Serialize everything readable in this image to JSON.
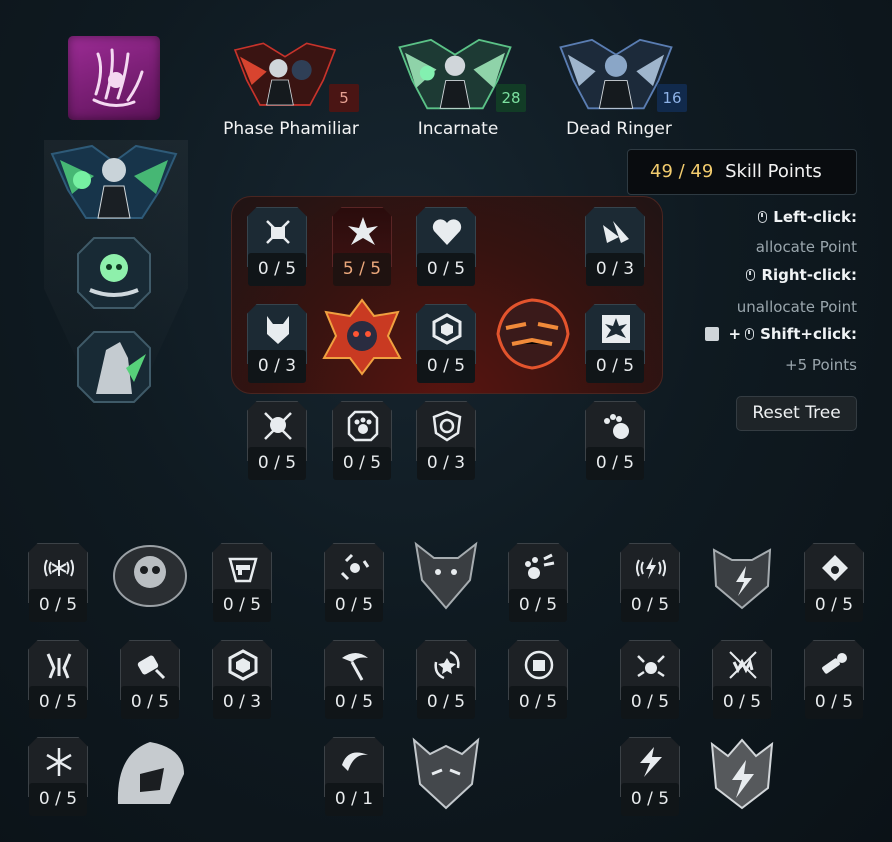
{
  "specs": [
    {
      "name": "Phase Phamiliar",
      "level": "5",
      "accent": "#c7332b",
      "level_bg": "#4a1514",
      "level_color": "#e7a193"
    },
    {
      "name": "Incarnate",
      "level": "28",
      "accent": "#5bc287",
      "level_bg": "#123c26",
      "level_color": "#7ce0a0"
    },
    {
      "name": "Dead Ringer",
      "level": "16",
      "accent": "#5a7db2",
      "level_bg": "#112a4c",
      "level_color": "#8eb2e7"
    }
  ],
  "points": {
    "spent": "49",
    "sep": " / ",
    "total": "49",
    "label": "Skill Points"
  },
  "hints": {
    "left_key": "Left-click:",
    "left_action": "allocate Point",
    "right_key": "Right-click:",
    "right_action": "unallocate Point",
    "plus": "+",
    "shift_key": "Shift+click:",
    "shift_action": "+5 Points"
  },
  "reset_label": "Reset Tree",
  "tree": {
    "row1": [
      "0 / 5",
      "5 / 5",
      "0 / 5",
      "0 / 3"
    ],
    "row2": [
      "0 / 3",
      "0 / 5",
      "0 / 5"
    ],
    "row3": [
      "0 / 5",
      "0 / 5",
      "0 / 3",
      "0 / 5"
    ]
  },
  "groups": [
    {
      "rows": [
        [
          "0 / 5",
          "0 / 5"
        ],
        [
          "0 / 5",
          "0 / 5",
          "0 / 3"
        ],
        [
          "0 / 5"
        ]
      ]
    },
    {
      "rows": [
        [
          "0 / 5",
          "0 / 5"
        ],
        [
          "0 / 5",
          "0 / 5",
          "0 / 5"
        ],
        [
          "0 / 1"
        ]
      ]
    },
    {
      "rows": [
        [
          "0 / 5",
          "0 / 5"
        ],
        [
          "0 / 5",
          "0 / 5",
          "0 / 5"
        ],
        [
          "0 / 5"
        ]
      ]
    }
  ],
  "colors": {
    "accent_gold": "#f2cc6e",
    "class_purple": "#9c2c95",
    "incarnate_green": "#5bc287"
  }
}
